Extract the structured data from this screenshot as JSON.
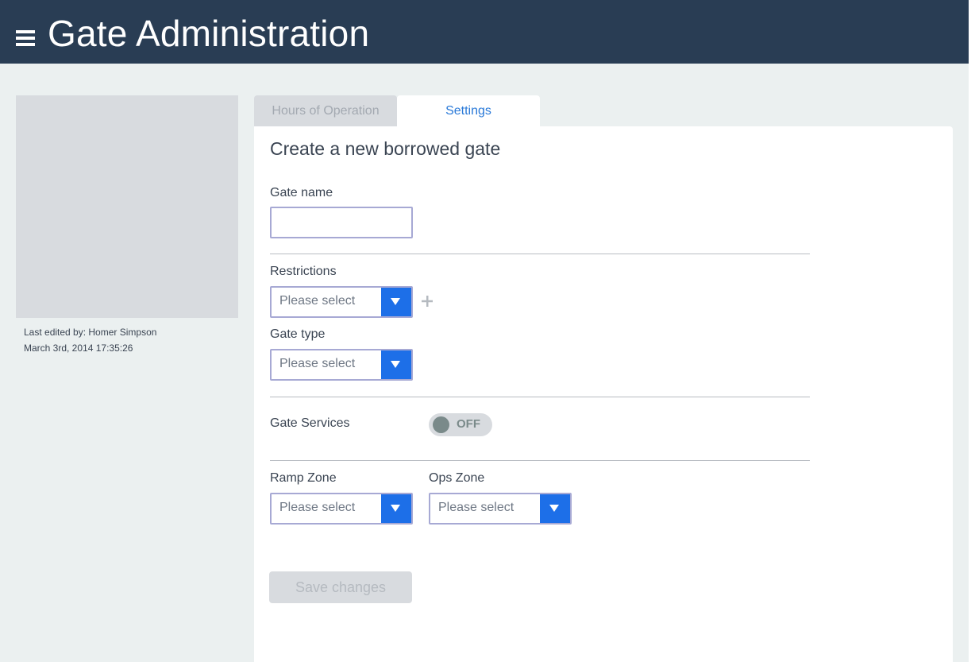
{
  "header": {
    "title": "Gate Administration",
    "menu_icon": "hamburger-menu-icon"
  },
  "sidebar": {
    "last_edited": "Last edited by: Homer Simpson",
    "edited_date": "March 3rd, 2014 17:35:26"
  },
  "tabs": [
    {
      "label": "Hours of Operation",
      "active": false
    },
    {
      "label": "Settings",
      "active": true
    }
  ],
  "form": {
    "title": "Create a new borrowed gate",
    "gate_name": {
      "label": "Gate name",
      "value": ""
    },
    "restrictions": {
      "label": "Restrictions",
      "value": "Please select"
    },
    "gate_type": {
      "label": "Gate type",
      "value": "Please select"
    },
    "gate_services": {
      "label": "Gate Services",
      "toggle_text": "OFF",
      "enabled": false
    },
    "ramp_zone": {
      "label": "Ramp Zone",
      "value": "Please select"
    },
    "ops_zone": {
      "label": "Ops Zone",
      "value": "Please select"
    },
    "save_label": "Save changes"
  },
  "colors": {
    "header_bg": "#293d54",
    "accent": "#1d6fe8",
    "tab_active_text": "#2979d8",
    "page_bg": "#ebf0f0"
  }
}
